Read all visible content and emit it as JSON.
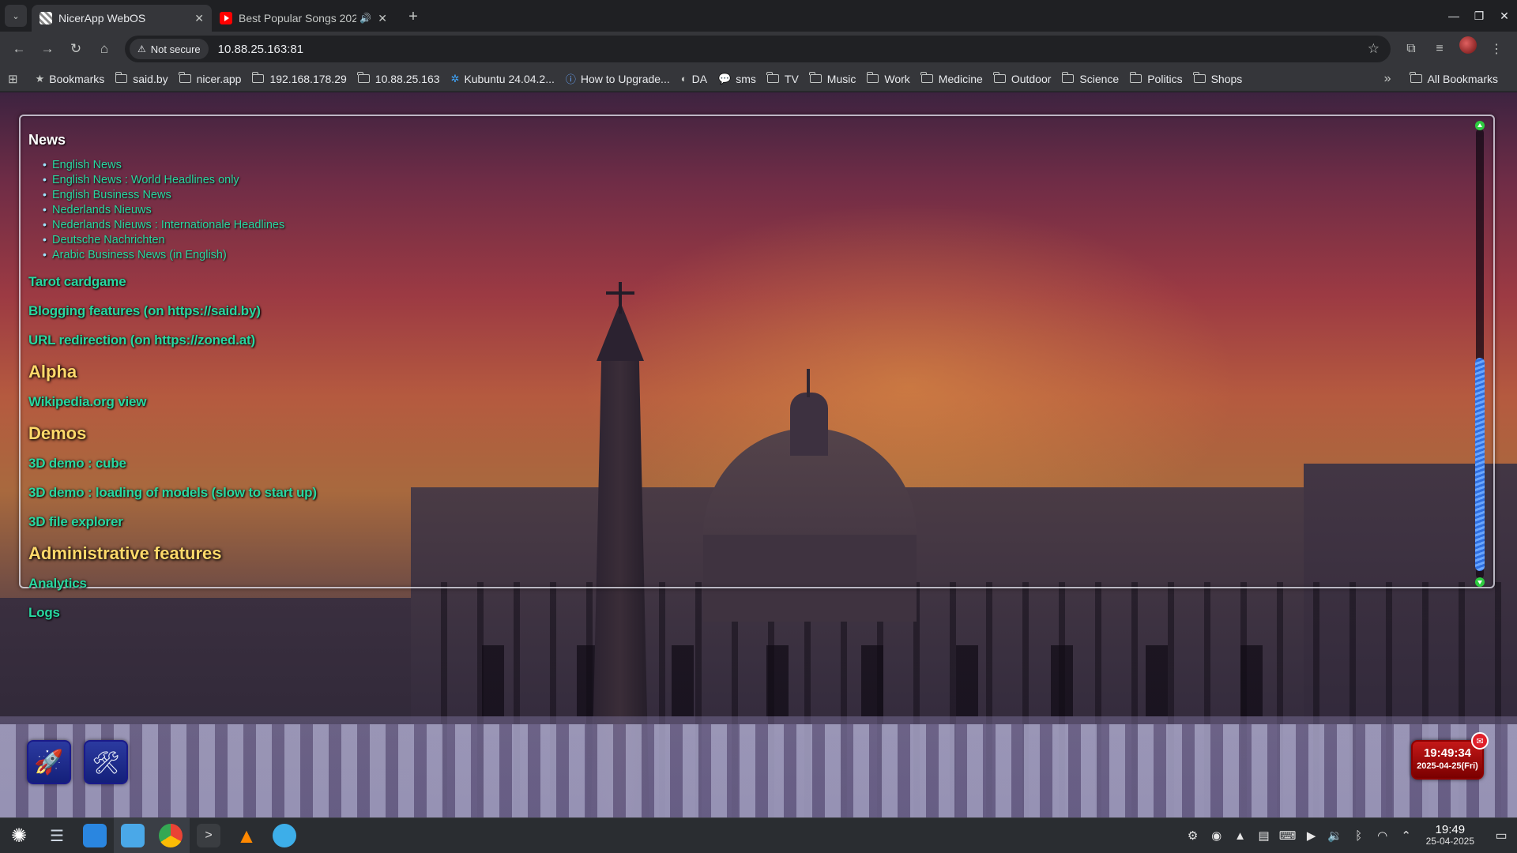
{
  "browser": {
    "tabs": [
      {
        "title": "NicerApp WebOS",
        "active": true
      },
      {
        "title": "Best Popular Songs 202",
        "active": false,
        "audio": true
      }
    ],
    "address": {
      "security_label": "Not secure",
      "url": "10.88.25.163:81"
    },
    "bookmarks": [
      {
        "label": "Bookmarks",
        "icon": "star-icon"
      },
      {
        "label": "said.by",
        "icon": "folder-icon"
      },
      {
        "label": "nicer.app",
        "icon": "folder-icon"
      },
      {
        "label": "192.168.178.29",
        "icon": "folder-icon"
      },
      {
        "label": "10.88.25.163",
        "icon": "folder-icon"
      },
      {
        "label": "Kubuntu 24.04.2...",
        "icon": "kubuntu-icon"
      },
      {
        "label": "How to Upgrade...",
        "icon": "info-icon"
      },
      {
        "label": "DA",
        "icon": "github-icon"
      },
      {
        "label": "sms",
        "icon": "chat-icon"
      },
      {
        "label": "TV",
        "icon": "folder-icon"
      },
      {
        "label": "Music",
        "icon": "folder-icon"
      },
      {
        "label": "Work",
        "icon": "folder-icon"
      },
      {
        "label": "Medicine",
        "icon": "folder-icon"
      },
      {
        "label": "Outdoor",
        "icon": "folder-icon"
      },
      {
        "label": "Science",
        "icon": "folder-icon"
      },
      {
        "label": "Politics",
        "icon": "folder-icon"
      },
      {
        "label": "Shops",
        "icon": "folder-icon"
      }
    ],
    "all_bookmarks_label": "All Bookmarks"
  },
  "page": {
    "news_heading": "News",
    "news_items": [
      "English News",
      "English News : World Headlines only",
      "English Business News",
      "Nederlands Nieuws",
      "Nederlands Nieuws : Internationale Headlines",
      "Deutsche Nachrichten",
      "Arabic Business News (in English)"
    ],
    "links_top": [
      "Tarot cardgame",
      "Blogging features (on https://said.by)",
      "URL redirection (on https://zoned.at)"
    ],
    "alpha_heading": "Alpha",
    "alpha_links": [
      "Wikipedia.org view"
    ],
    "demos_heading": "Demos",
    "demos_links": [
      "3D demo : cube",
      "3D demo : loading of models (slow to start up)",
      "3D file explorer"
    ],
    "admin_heading": "Administrative features",
    "admin_links": [
      "Analytics",
      "Logs"
    ],
    "clock": {
      "time": "19:49:34",
      "date": "2025-04-25(Fri)"
    }
  },
  "taskbar": {
    "apps": [
      "kde-launcher-icon",
      "system-settings-icon",
      "discover-store-icon",
      "file-manager-icon",
      "chrome-icon",
      "terminal-icon",
      "vlc-icon",
      "kde-connect-icon"
    ],
    "time": "19:49",
    "date": "25-04-2025"
  },
  "colors": {
    "link": "#28d8a0",
    "section_heading": "#ffd96a",
    "clock_bg": "#c41818"
  }
}
